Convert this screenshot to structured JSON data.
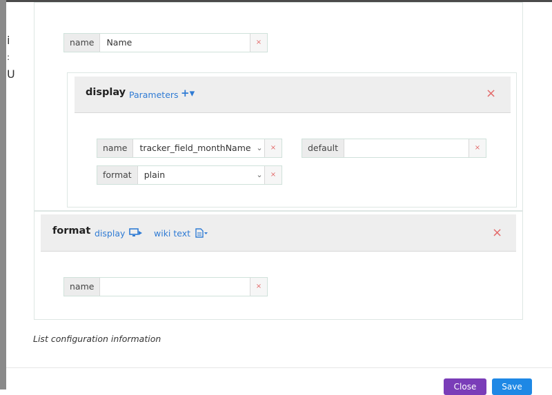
{
  "background": {
    "side_chars": [
      "i",
      ":",
      "U"
    ]
  },
  "name_field_top": {
    "label": "name",
    "value": "Name",
    "clear": "×"
  },
  "display_panel": {
    "title": "display",
    "params_link": "Parameters",
    "add_icon": "+▾",
    "close": "×",
    "name_field": {
      "label": "name",
      "value": "tracker_field_monthName",
      "chevron": "⌄",
      "clear": "×"
    },
    "default_field": {
      "label": "default",
      "value": "",
      "clear": "×"
    },
    "format_field": {
      "label": "format",
      "value": "plain",
      "chevron": "⌄",
      "clear": "×"
    }
  },
  "format_panel": {
    "title": "format",
    "display_link": "display",
    "display_icon": "monitor-icon",
    "wiki_link": "wiki text",
    "wiki_icon": "document-icon",
    "close": "×",
    "name_field": {
      "label": "name",
      "value": "",
      "clear": "×"
    }
  },
  "info_text": "List configuration information",
  "footer": {
    "close_label": "Close",
    "save_label": "Save"
  },
  "colors": {
    "link": "#2f7bd4",
    "close": "#e36a6a",
    "close_btn": "#7a3db8",
    "save_btn": "#1e88e5"
  }
}
